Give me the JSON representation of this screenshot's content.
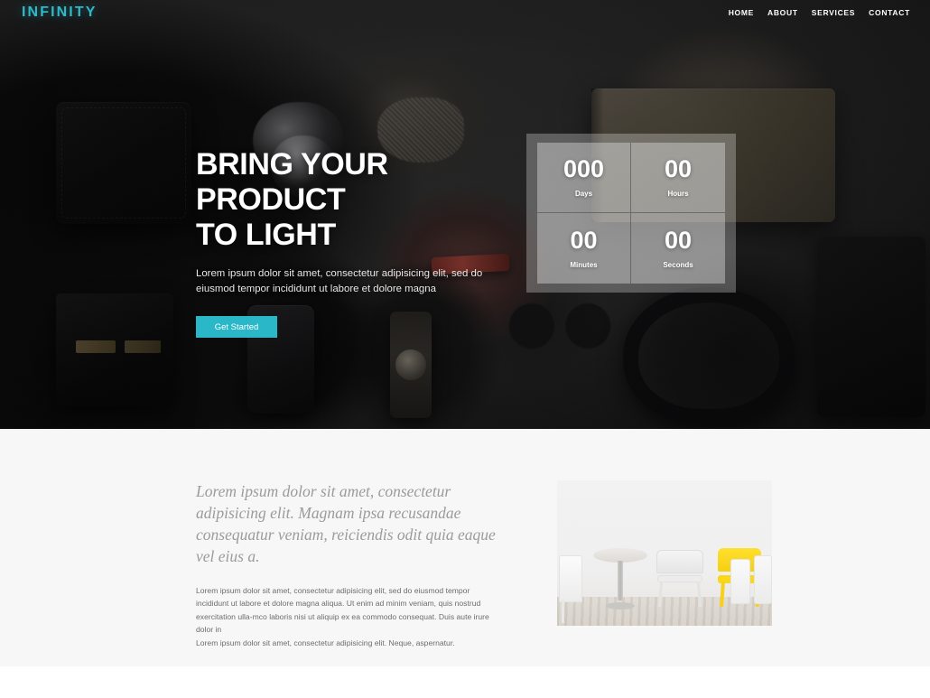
{
  "header": {
    "logo": "INFINITY",
    "nav": [
      {
        "label": "HOME"
      },
      {
        "label": "ABOUT"
      },
      {
        "label": "SERVICES"
      },
      {
        "label": "CONTACT"
      }
    ]
  },
  "hero": {
    "title_line1": "BRING YOUR PRODUCT",
    "title_line2": "TO LIGHT",
    "subtitle": "Lorem ipsum dolor sit amet, consectetur adipisicing elit, sed do eiusmod tempor incididunt ut labore et dolore magna",
    "cta_label": "Get Started",
    "accent_color": "#2ab7c8",
    "countdown": [
      {
        "value": "000",
        "label": "Days"
      },
      {
        "value": "00",
        "label": "Hours"
      },
      {
        "value": "00",
        "label": "Minutes"
      },
      {
        "value": "00",
        "label": "Seconds"
      }
    ]
  },
  "about": {
    "heading": "Lorem ipsum dolor sit amet, consectetur adipisicing elit. Magnam ipsa recusandae consequatur veniam, reiciendis odit quia eaque vel eius a.",
    "paragraph1": "Lorem ipsum dolor sit amet, consectetur adipisicing elit, sed do eiusmod tempor incididunt ut labore et dolore magna aliqua. Ut enim ad minim veniam, quis nostrud exercitation ulla-mco laboris nisi ut aliquip ex ea commodo consequat. Duis aute irure dolor in",
    "paragraph2": "Lorem ipsum dolor sit amet, consectetur adipisicing elit. Neque, aspernatur.",
    "image_alt": "row-of-white-chairs-with-one-yellow-chair"
  }
}
